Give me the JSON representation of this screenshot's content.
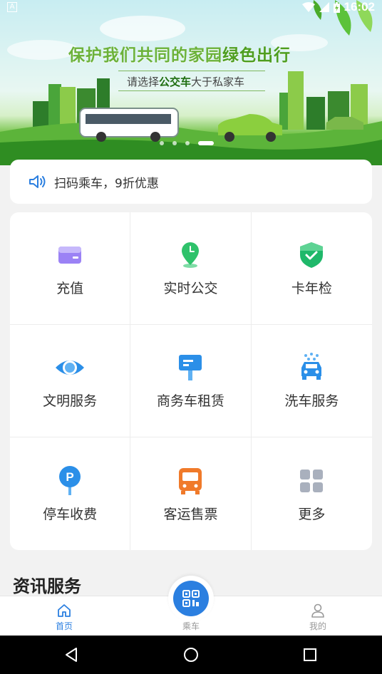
{
  "status_bar": {
    "app_icon": "A",
    "time": "16:02"
  },
  "banner": {
    "title_main": "保护我们共同的家园",
    "title_green": "绿色出行",
    "sub_prefix": "请选择",
    "sub_bold": "公交车",
    "sub_suffix": "大于私家车",
    "dots": 4,
    "active_dot": 3
  },
  "notice": {
    "icon": "speaker-icon",
    "text": "扫码乘车，9折优惠"
  },
  "services": [
    {
      "label": "充值",
      "icon": "card-icon",
      "color": "#8b6ff0"
    },
    {
      "label": "实时公交",
      "icon": "clock-pin-icon",
      "color": "#2fc26b"
    },
    {
      "label": "卡年检",
      "icon": "shield-check-icon",
      "color": "#1fb86a"
    },
    {
      "label": "文明服务",
      "icon": "eye-icon",
      "color": "#2b8fe8"
    },
    {
      "label": "商务车租赁",
      "icon": "signpost-icon",
      "color": "#2b8fe8"
    },
    {
      "label": "洗车服务",
      "icon": "car-wash-icon",
      "color": "#2b8fe8"
    },
    {
      "label": "停车收费",
      "icon": "parking-icon",
      "color": "#2b8fe8"
    },
    {
      "label": "客运售票",
      "icon": "bus-icon",
      "color": "#f07a2a"
    },
    {
      "label": "更多",
      "icon": "grid-more-icon",
      "color": "#a9b0bd"
    }
  ],
  "section": {
    "title": "资讯服务"
  },
  "bottom_nav": {
    "home": "首页",
    "ride": "乘车",
    "mine": "我的",
    "active_color": "#2b7fe0"
  }
}
